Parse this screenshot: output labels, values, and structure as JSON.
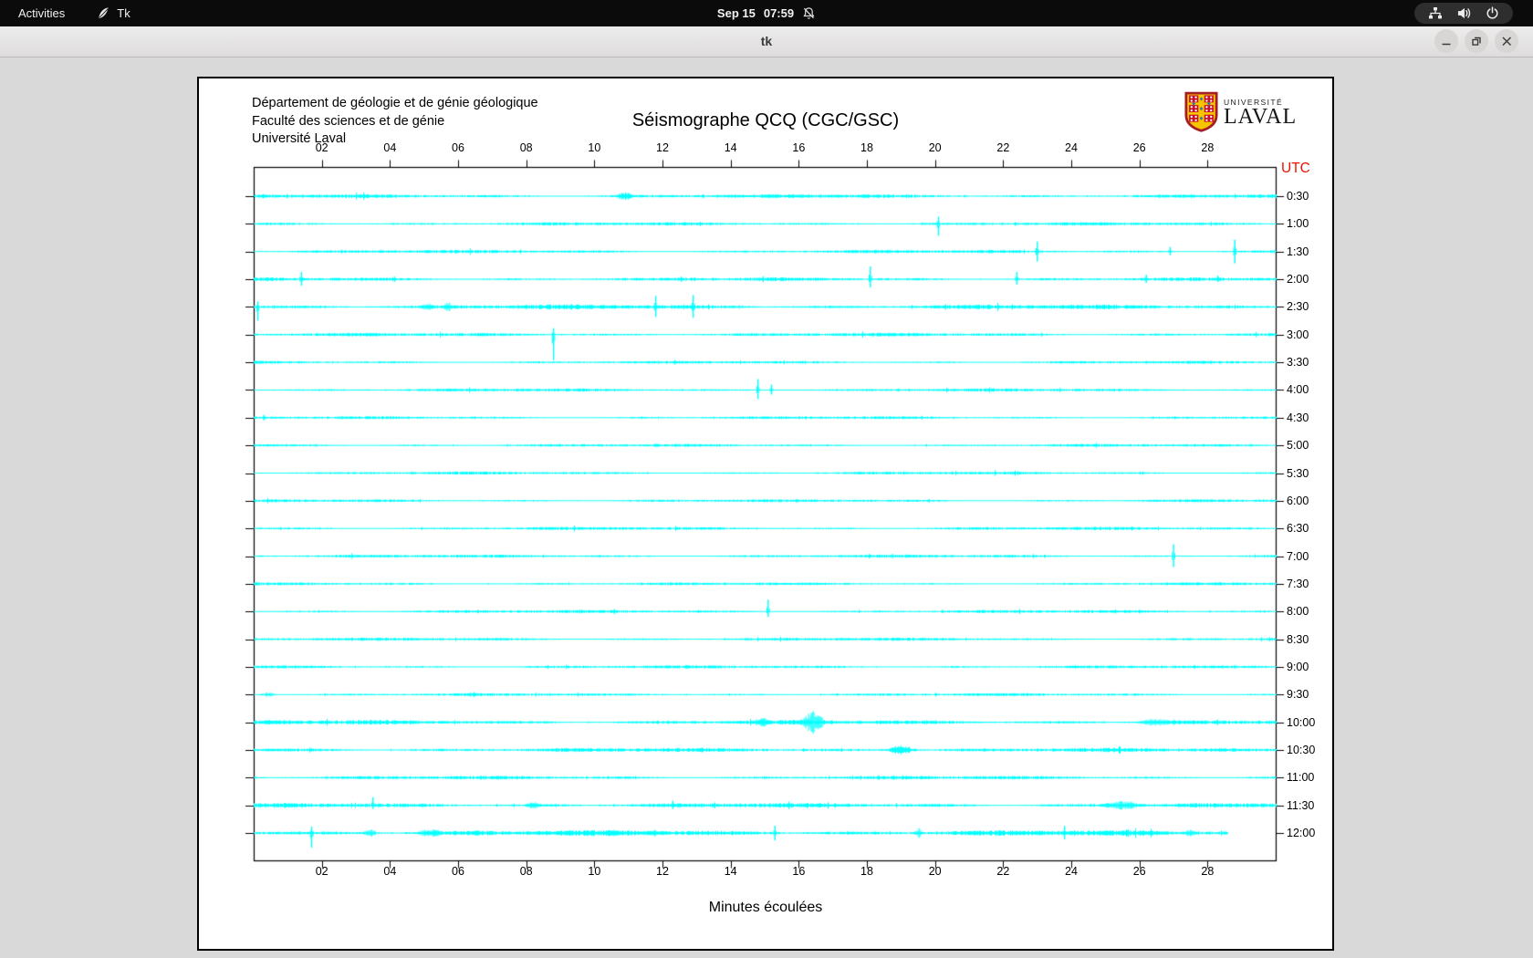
{
  "desktop": {
    "top_bar": {
      "activities": "Activities",
      "app_name": "Tk",
      "clock_date": "Sep 15",
      "clock_time": "07:59",
      "notifications_muted": true,
      "tray_icons": [
        "network",
        "volume",
        "power"
      ]
    },
    "window": {
      "title": "tk",
      "controls": [
        "minimize",
        "maximize",
        "close"
      ]
    }
  },
  "figure": {
    "header_lines": [
      "Département de géologie et de génie géologique",
      "Faculté des sciences et de génie",
      "Université Laval"
    ],
    "title": "Séismographe QCQ (CGC/GSC)",
    "utc_label": "UTC",
    "xlabel": "Minutes écoulées",
    "logo": {
      "line1": "UNIVERSITÉ",
      "line2": "LAVAL"
    }
  },
  "colors": {
    "trace": "#00ffff",
    "utc_label": "#ee1100",
    "frame": "#000000",
    "window_background": "#d9d9d9",
    "canvas_background": "#ffffff",
    "topbar_background": "#0b0b0b",
    "logo_gold": "#f7c400",
    "logo_red": "#c8102e",
    "logo_blue": "#2978b5"
  },
  "chart_data": {
    "type": "line",
    "title": "Séismographe QCQ (CGC/GSC)",
    "xlabel": "Minutes écoulées",
    "ylabel": "UTC",
    "x_range_minutes": [
      0,
      30
    ],
    "x_ticks": [
      "02",
      "04",
      "06",
      "08",
      "10",
      "12",
      "14",
      "16",
      "18",
      "20",
      "22",
      "24",
      "26",
      "28"
    ],
    "grid": false,
    "trace_color": "#00ffff",
    "rows": [
      {
        "utc": "0:30",
        "noise": 1.6,
        "events": [
          {
            "t": "b",
            "m": 10.9,
            "a": 4,
            "w": 0.4
          },
          {
            "t": "b",
            "m": 17.9,
            "a": 3.5,
            "w": 0.25
          }
        ]
      },
      {
        "utc": "1:00",
        "noise": 1.4,
        "events": [
          {
            "t": "s",
            "m": 20.1,
            "up": 8,
            "dn": 13
          }
        ]
      },
      {
        "utc": "1:30",
        "noise": 1.4,
        "events": [
          {
            "t": "s",
            "m": 23.0,
            "up": 11,
            "dn": 11
          },
          {
            "t": "s",
            "m": 26.9,
            "up": 5,
            "dn": 4
          },
          {
            "t": "s",
            "m": 28.8,
            "up": 13,
            "dn": 13
          }
        ]
      },
      {
        "utc": "2:00",
        "noise": 1.5,
        "events": [
          {
            "t": "s",
            "m": 1.4,
            "up": 8,
            "dn": 7
          },
          {
            "t": "s",
            "m": 18.1,
            "up": 14,
            "dn": 9
          },
          {
            "t": "s",
            "m": 22.4,
            "up": 8,
            "dn": 6
          },
          {
            "t": "s",
            "m": 26.2,
            "up": 5,
            "dn": 4
          },
          {
            "t": "s",
            "m": 28.3,
            "up": 4,
            "dn": 3
          }
        ]
      },
      {
        "utc": "2:30",
        "noise": 2.0,
        "events": [
          {
            "t": "s",
            "m": 0.12,
            "up": 6,
            "dn": 15
          },
          {
            "t": "b",
            "m": 5.1,
            "a": 4,
            "w": 0.35
          },
          {
            "t": "b",
            "m": 5.7,
            "a": 5,
            "w": 0.2
          },
          {
            "t": "s",
            "m": 11.8,
            "up": 12,
            "dn": 11
          },
          {
            "t": "s",
            "m": 12.9,
            "up": 13,
            "dn": 12
          }
        ]
      },
      {
        "utc": "3:00",
        "noise": 1.5,
        "events": [
          {
            "t": "s",
            "m": 8.8,
            "up": 7,
            "dn": 28
          }
        ]
      },
      {
        "utc": "3:30",
        "noise": 1.2,
        "events": []
      },
      {
        "utc": "4:00",
        "noise": 1.3,
        "events": [
          {
            "t": "s",
            "m": 14.8,
            "up": 12,
            "dn": 10
          },
          {
            "t": "s",
            "m": 15.2,
            "up": 6,
            "dn": 5
          }
        ]
      },
      {
        "utc": "4:30",
        "noise": 1.2,
        "events": [
          {
            "t": "s",
            "m": 0.3,
            "up": 3,
            "dn": 3
          }
        ]
      },
      {
        "utc": "5:00",
        "noise": 1.2,
        "events": []
      },
      {
        "utc": "5:30",
        "noise": 1.2,
        "events": []
      },
      {
        "utc": "6:00",
        "noise": 1.2,
        "events": []
      },
      {
        "utc": "6:30",
        "noise": 1.3,
        "events": []
      },
      {
        "utc": "7:00",
        "noise": 1.3,
        "events": [
          {
            "t": "s",
            "m": 27.0,
            "up": 13,
            "dn": 12
          }
        ]
      },
      {
        "utc": "7:30",
        "noise": 1.2,
        "events": []
      },
      {
        "utc": "8:00",
        "noise": 1.3,
        "events": [
          {
            "t": "s",
            "m": 15.1,
            "up": 13,
            "dn": 6
          }
        ]
      },
      {
        "utc": "8:30",
        "noise": 1.3,
        "events": []
      },
      {
        "utc": "9:00",
        "noise": 1.3,
        "events": []
      },
      {
        "utc": "9:30",
        "noise": 1.2,
        "events": [
          {
            "t": "b",
            "m": 0.4,
            "a": 2.5,
            "w": 0.3
          }
        ]
      },
      {
        "utc": "10:00",
        "noise": 1.9,
        "events": [
          {
            "t": "b",
            "m": 0.5,
            "a": 3,
            "w": 0.5
          },
          {
            "t": "b",
            "m": 14.9,
            "a": 5,
            "w": 0.4
          },
          {
            "t": "b",
            "m": 16.4,
            "a": 12,
            "w": 0.5
          },
          {
            "t": "b",
            "m": 26.5,
            "a": 4,
            "w": 0.8
          }
        ]
      },
      {
        "utc": "10:30",
        "noise": 1.7,
        "events": [
          {
            "t": "b",
            "m": 19.0,
            "a": 5,
            "w": 0.6
          }
        ]
      },
      {
        "utc": "11:00",
        "noise": 1.5,
        "events": []
      },
      {
        "utc": "11:30",
        "noise": 1.9,
        "events": [
          {
            "t": "s",
            "m": 3.5,
            "up": 9,
            "dn": 4
          },
          {
            "t": "b",
            "m": 8.2,
            "a": 3.5,
            "w": 0.4
          },
          {
            "t": "s",
            "m": 12.3,
            "up": 5,
            "dn": 4
          },
          {
            "t": "b",
            "m": 25.5,
            "a": 4.5,
            "w": 1.0
          }
        ]
      },
      {
        "utc": "12:00",
        "noise": 2.4,
        "end": 28.6,
        "events": [
          {
            "t": "s",
            "m": 1.7,
            "up": 7,
            "dn": 16
          },
          {
            "t": "b",
            "m": 3.4,
            "a": 4,
            "w": 0.3
          },
          {
            "t": "b",
            "m": 5.2,
            "a": 4.5,
            "w": 0.6
          },
          {
            "t": "b",
            "m": 6.5,
            "a": 3.5,
            "w": 0.3
          },
          {
            "t": "b",
            "m": 10.6,
            "a": 4,
            "w": 0.3
          },
          {
            "t": "b",
            "m": 11.7,
            "a": 4,
            "w": 0.3
          },
          {
            "t": "s",
            "m": 15.3,
            "up": 8,
            "dn": 8
          },
          {
            "t": "b",
            "m": 19.5,
            "a": 5,
            "w": 0.2
          },
          {
            "t": "s",
            "m": 23.8,
            "up": 8,
            "dn": 7
          },
          {
            "t": "b",
            "m": 25.6,
            "a": 4,
            "w": 0.4
          },
          {
            "t": "b",
            "m": 27.5,
            "a": 4,
            "w": 0.3
          }
        ]
      }
    ]
  }
}
